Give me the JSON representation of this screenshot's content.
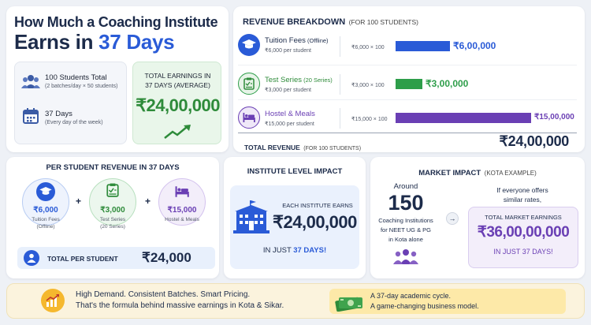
{
  "hero": {
    "title_line1": "How Much a Coaching Institute",
    "title_line2_prefix": "Earns in ",
    "title_line2_highlight": "37 Days",
    "students_title": "100 Students Total",
    "students_sub": "(2 batches/day × 50 students)",
    "days_title": "37 Days",
    "days_sub": "(Every day of the week)",
    "total_label_line1": "TOTAL EARNINGS IN",
    "total_label_line2": "37 DAYS (AVERAGE)",
    "total_value": "₹24,00,000"
  },
  "revenue": {
    "title": "REVENUE BREAKDOWN",
    "title_note": "(FOR 100 STUDENTS)",
    "rows": [
      {
        "name": "Tuition Fees",
        "name_note": " (Offline)",
        "per": "₹6,000 per student",
        "formula": "₹6,000 × 100",
        "value": "₹6,00,000",
        "amount": 600000,
        "color": "#2a5bd7"
      },
      {
        "name": "Test Series",
        "name_note": " (20 Series)",
        "per": "₹3,000 per student",
        "formula": "₹3,000 × 100",
        "value": "₹3,00,000",
        "amount": 300000,
        "color": "#2e9e4a"
      },
      {
        "name": "Hostel & Meals",
        "name_note": "",
        "per": "₹15,000 per student",
        "formula": "₹15,000 × 100",
        "value": "₹15,00,000",
        "amount": 1500000,
        "color": "#6a3fb4"
      }
    ],
    "total_label": "TOTAL REVENUE",
    "total_note": "(FOR 100 STUDENTS)",
    "total_value": "₹24,00,000"
  },
  "per_student": {
    "title": "PER STUDENT REVENUE IN 37 DAYS",
    "items": [
      {
        "value": "₹6,000",
        "label1": "Tuition Fees",
        "label2": "(Offline)"
      },
      {
        "value": "₹3,000",
        "label1": "Test Series",
        "label2": "(20 Series)"
      },
      {
        "value": "₹15,000",
        "label1": "Hostel & Meals",
        "label2": ""
      }
    ],
    "plus": "+",
    "total_label": "TOTAL PER STUDENT",
    "total_value": "₹24,000"
  },
  "institute": {
    "title": "INSTITUTE LEVEL IMPACT",
    "each": "EACH INSTITUTE EARNS",
    "value": "₹24,00,000",
    "footer_prefix": "IN JUST ",
    "footer_highlight": "37 DAYS!"
  },
  "market": {
    "title": "MARKET IMPACT",
    "title_note": "(KOTA EXAMPLE)",
    "around": "Around",
    "count": "150",
    "desc1": "Coaching Institutions",
    "desc2": "for NEET UG & PG",
    "desc3": "in Kota alone",
    "arrow": "→",
    "if_line1": "If everyone offers",
    "if_line2": "similar rates,",
    "total_label": "TOTAL MARKET EARNINGS",
    "total_value": "₹36,00,00,000",
    "footer": "IN JUST 37 DAYS!"
  },
  "bottom": {
    "line1": "High Demand. Consistent Batches. Smart Pricing.",
    "line2": "That's the formula behind massive earnings in Kota & Sikar.",
    "right1": "A 37-day academic cycle.",
    "right2": "A game-changing business model."
  }
}
